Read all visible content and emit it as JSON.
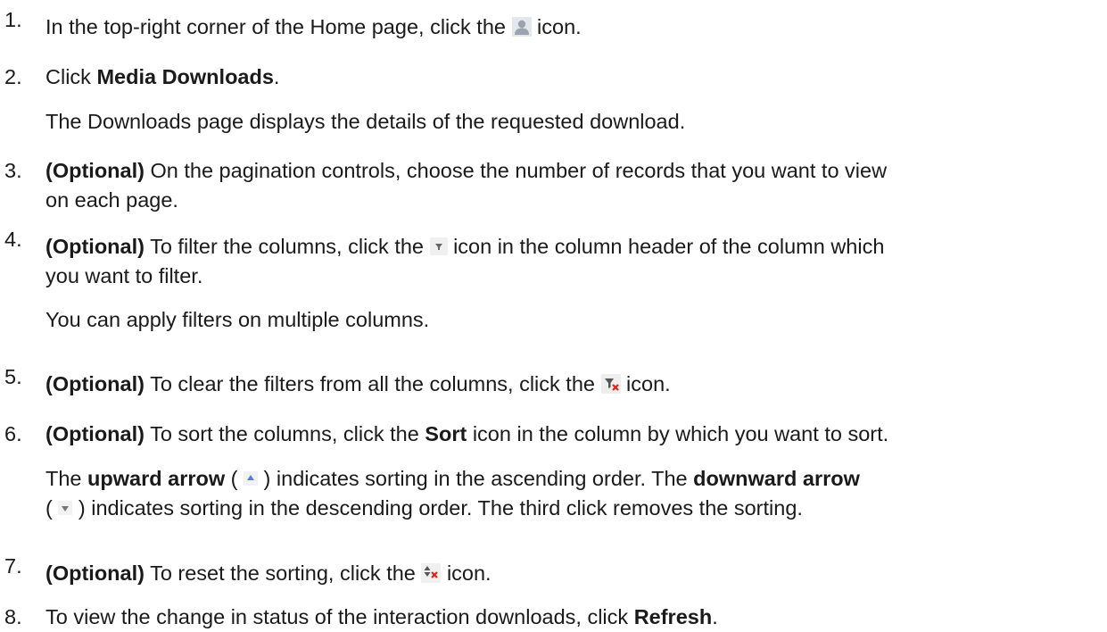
{
  "steps": [
    {
      "number": "1.",
      "text_a": "In the top-right corner of the Home page, click the",
      "icon": "user-icon",
      "text_b": "icon."
    },
    {
      "number": "2.",
      "text_a": "Click",
      "bold_a": "Media Downloads",
      "text_b": ".",
      "note": "The Downloads page displays the details of the requested download."
    },
    {
      "number": "3.",
      "bold_a": "(Optional)",
      "text_a": "On the pagination controls, choose the number of records that you want to view",
      "text_b": "on each page."
    },
    {
      "number": "4.",
      "bold_a": "(Optional)",
      "text_a": "To filter the columns, click the",
      "icon": "filter-icon",
      "text_b": "icon in the column header of the column which",
      "text_c": "you want to filter.",
      "note": "You can apply filters on multiple columns."
    },
    {
      "number": "5.",
      "bold_a": "(Optional)",
      "text_a": "To clear the filters from all the columns, click the",
      "icon": "clear-filter-icon",
      "text_b": "icon."
    },
    {
      "number": "6.",
      "bold_a": "(Optional)",
      "text_a": "To sort the columns, click the",
      "bold_b": "Sort",
      "text_b": "icon in the column by which you want to sort.",
      "note_a": "The",
      "note_bold_a": "upward arrow",
      "note_b": "(",
      "note_icon_a": "sort-ascending-icon",
      "note_c": ") indicates sorting in the ascending order. The",
      "note_bold_b": "downward arrow",
      "note_d": "(",
      "note_icon_b": "sort-descending-icon",
      "note_e": ") indicates sorting in the descending order. The third click removes the sorting."
    },
    {
      "number": "7.",
      "bold_a": "(Optional)",
      "text_a": "To reset the sorting, click the",
      "icon": "reset-sort-icon",
      "text_b": "icon."
    },
    {
      "number": "8.",
      "text_a": "To view the change in status of the interaction downloads, click",
      "bold_a": "Refresh",
      "text_b": "."
    }
  ]
}
